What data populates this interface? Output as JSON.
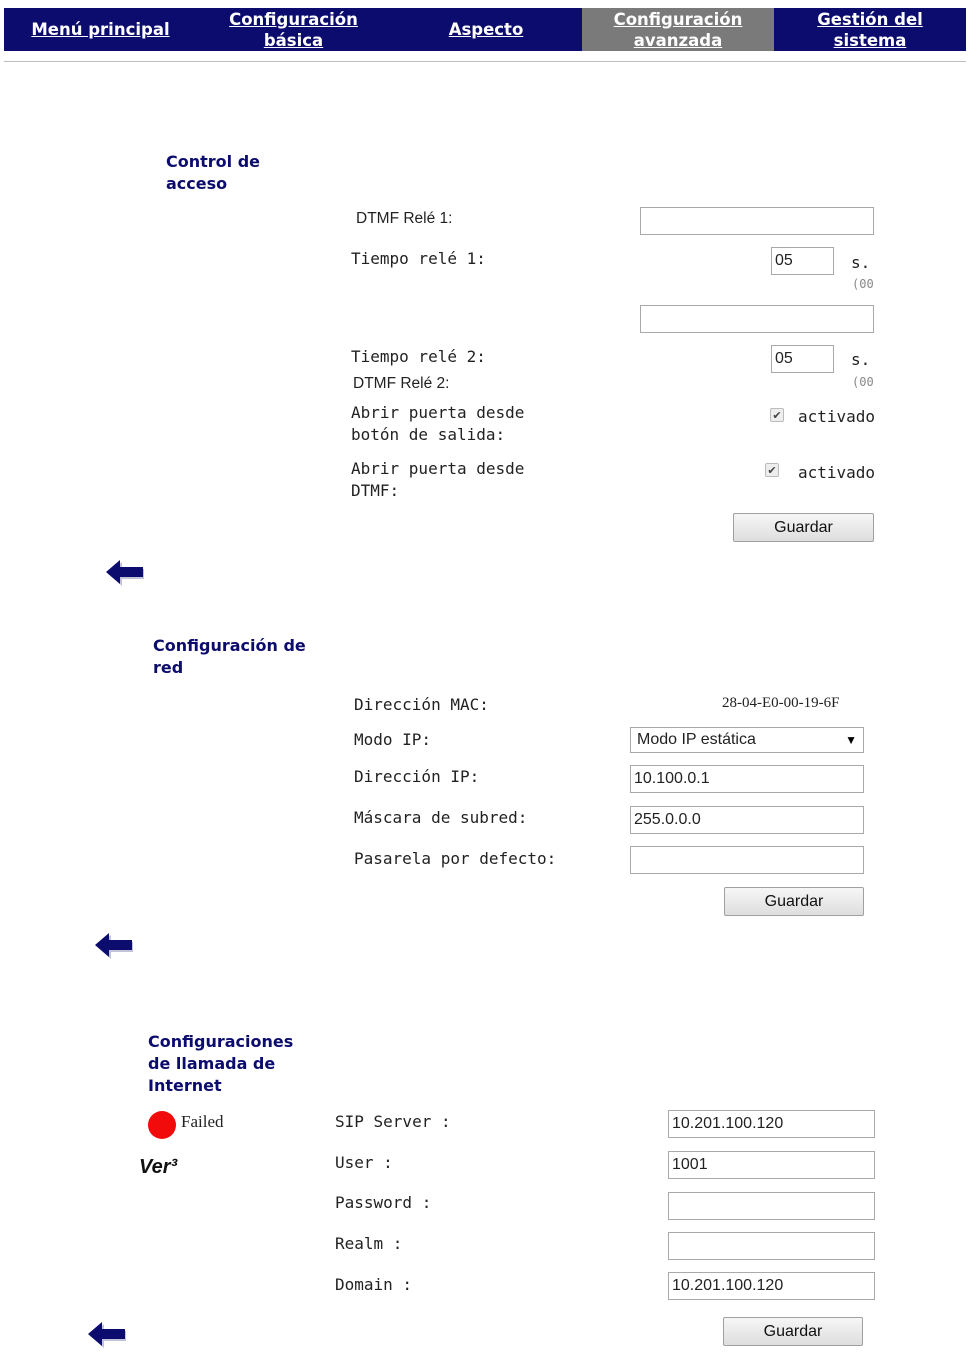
{
  "nav": {
    "items": [
      {
        "label": "Menú principal"
      },
      {
        "label": "Configuración básica"
      },
      {
        "label": "Aspecto"
      },
      {
        "label": "Configuración avanzada"
      },
      {
        "label": "Gestión del sistema"
      }
    ],
    "active_index": 3
  },
  "access_control": {
    "title": "Control de acceso",
    "dtmf_relay1_label": "DTMF Relé 1:",
    "dtmf_relay1_value": "",
    "time_relay1_label": "Tiempo relé 1:",
    "time_relay1_value": "05",
    "time_relay1_unit": "s.",
    "time_relay1_hint": "(00",
    "dtmf_relay2_value": "",
    "time_relay2_label": "Tiempo relé 2:",
    "time_relay2_value": "05",
    "time_relay2_unit": "s.",
    "time_relay2_hint": "(00",
    "dtmf_relay2_label": "DTMF Relé 2:",
    "exit_button_label_line1": "Abrir puerta desde",
    "exit_button_label_line2": "botón de salida:",
    "exit_button_checked": true,
    "exit_button_check_label": "activado",
    "dtmf_open_label_line1": "Abrir puerta desde",
    "dtmf_open_label_line2": "DTMF:",
    "dtmf_open_checked": true,
    "dtmf_open_check_label": "activado",
    "save_label": "Guardar"
  },
  "network": {
    "title": "Configuración de red",
    "mac_label": "Dirección MAC:",
    "mac_value": "28-04-E0-00-19-6F",
    "ip_mode_label": "Modo IP:",
    "ip_mode_value": "Modo IP estática",
    "ip_label": "Dirección IP:",
    "ip_value": "10.100.0.1",
    "mask_label": "Máscara de subred:",
    "mask_value": "255.0.0.0",
    "gateway_label": "Pasarela por defecto:",
    "gateway_value": "",
    "save_label": "Guardar"
  },
  "sip": {
    "title": "Configuraciones de llamada de Internet",
    "status_text": "Failed",
    "status_color": "#f20b0b",
    "version_text": "Ver³",
    "server_label": "SIP Server :",
    "server_value": "10.201.100.120",
    "user_label": "User :",
    "user_value": "1001",
    "password_label": "Password :",
    "password_value": "",
    "realm_label": "Realm :",
    "realm_value": "",
    "domain_label": "Domain :",
    "domain_value": "10.201.100.120",
    "save_label": "Guardar"
  },
  "colors": {
    "nav_bg": "#0c0c6e",
    "nav_active_bg": "#7a7a7a",
    "title_color": "#0c0c6e",
    "arrow_color": "#0c0c6e"
  }
}
